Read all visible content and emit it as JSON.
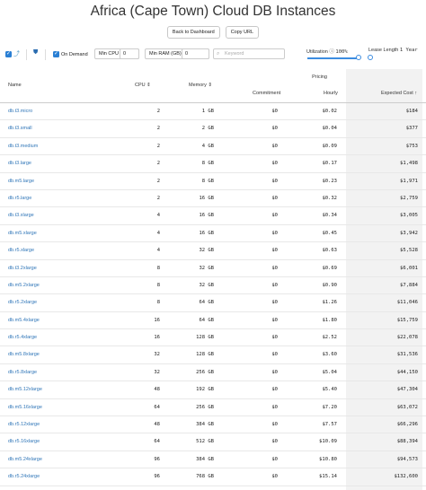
{
  "page": {
    "title": "Africa (Cape Town) Cloud DB Instances"
  },
  "buttons": {
    "back_label": "Back to Dashboard",
    "copy_label": "Copy URL"
  },
  "toolbar": {
    "on_demand_label": "On Demand",
    "min_cpu_label": "Min CPU",
    "min_cpu_value": "0",
    "min_ram_label": "Min RAM (GB)",
    "min_ram_value": "0",
    "keyword_placeholder": "Keyword",
    "utilization_label": "Utilization",
    "utilization_value": "100%",
    "lease_label": "Lease Length",
    "lease_value": "1 Year",
    "accent": "#3c8ce0"
  },
  "table": {
    "group_header": "Pricing",
    "columns": {
      "name": "Name",
      "cpu": "CPU",
      "memory": "Memory",
      "commitment": "Commitment",
      "hourly": "Hourly",
      "expected": "Expected Cost"
    },
    "rows": [
      {
        "name": "db.t3.micro",
        "cpu": "2",
        "memory": "1 GB",
        "commitment": "$0",
        "hourly": "$0.02",
        "expected": "$184"
      },
      {
        "name": "db.t3.small",
        "cpu": "2",
        "memory": "2 GB",
        "commitment": "$0",
        "hourly": "$0.04",
        "expected": "$377"
      },
      {
        "name": "db.t3.medium",
        "cpu": "2",
        "memory": "4 GB",
        "commitment": "$0",
        "hourly": "$0.09",
        "expected": "$753"
      },
      {
        "name": "db.t3.large",
        "cpu": "2",
        "memory": "8 GB",
        "commitment": "$0",
        "hourly": "$0.17",
        "expected": "$1,498"
      },
      {
        "name": "db.m5.large",
        "cpu": "2",
        "memory": "8 GB",
        "commitment": "$0",
        "hourly": "$0.23",
        "expected": "$1,971"
      },
      {
        "name": "db.r5.large",
        "cpu": "2",
        "memory": "16 GB",
        "commitment": "$0",
        "hourly": "$0.32",
        "expected": "$2,759"
      },
      {
        "name": "db.t3.xlarge",
        "cpu": "4",
        "memory": "16 GB",
        "commitment": "$0",
        "hourly": "$0.34",
        "expected": "$3,005"
      },
      {
        "name": "db.m5.xlarge",
        "cpu": "4",
        "memory": "16 GB",
        "commitment": "$0",
        "hourly": "$0.45",
        "expected": "$3,942"
      },
      {
        "name": "db.r5.xlarge",
        "cpu": "4",
        "memory": "32 GB",
        "commitment": "$0",
        "hourly": "$0.63",
        "expected": "$5,528"
      },
      {
        "name": "db.t3.2xlarge",
        "cpu": "8",
        "memory": "32 GB",
        "commitment": "$0",
        "hourly": "$0.69",
        "expected": "$6,001"
      },
      {
        "name": "db.m5.2xlarge",
        "cpu": "8",
        "memory": "32 GB",
        "commitment": "$0",
        "hourly": "$0.90",
        "expected": "$7,884"
      },
      {
        "name": "db.r5.2xlarge",
        "cpu": "8",
        "memory": "64 GB",
        "commitment": "$0",
        "hourly": "$1.26",
        "expected": "$11,046"
      },
      {
        "name": "db.m5.4xlarge",
        "cpu": "16",
        "memory": "64 GB",
        "commitment": "$0",
        "hourly": "$1.80",
        "expected": "$15,759"
      },
      {
        "name": "db.r5.4xlarge",
        "cpu": "16",
        "memory": "128 GB",
        "commitment": "$0",
        "hourly": "$2.52",
        "expected": "$22,078"
      },
      {
        "name": "db.m5.8xlarge",
        "cpu": "32",
        "memory": "128 GB",
        "commitment": "$0",
        "hourly": "$3.60",
        "expected": "$31,536"
      },
      {
        "name": "db.r5.8xlarge",
        "cpu": "32",
        "memory": "256 GB",
        "commitment": "$0",
        "hourly": "$5.04",
        "expected": "$44,150"
      },
      {
        "name": "db.m5.12xlarge",
        "cpu": "48",
        "memory": "192 GB",
        "commitment": "$0",
        "hourly": "$5.40",
        "expected": "$47,304"
      },
      {
        "name": "db.m5.16xlarge",
        "cpu": "64",
        "memory": "256 GB",
        "commitment": "$0",
        "hourly": "$7.20",
        "expected": "$63,072"
      },
      {
        "name": "db.r5.12xlarge",
        "cpu": "48",
        "memory": "384 GB",
        "commitment": "$0",
        "hourly": "$7.57",
        "expected": "$66,296"
      },
      {
        "name": "db.r5.16xlarge",
        "cpu": "64",
        "memory": "512 GB",
        "commitment": "$0",
        "hourly": "$10.09",
        "expected": "$88,394"
      },
      {
        "name": "db.m5.24xlarge",
        "cpu": "96",
        "memory": "384 GB",
        "commitment": "$0",
        "hourly": "$10.80",
        "expected": "$94,573"
      },
      {
        "name": "db.r5.24xlarge",
        "cpu": "96",
        "memory": "768 GB",
        "commitment": "$0",
        "hourly": "$15.14",
        "expected": "$132,600"
      }
    ]
  }
}
